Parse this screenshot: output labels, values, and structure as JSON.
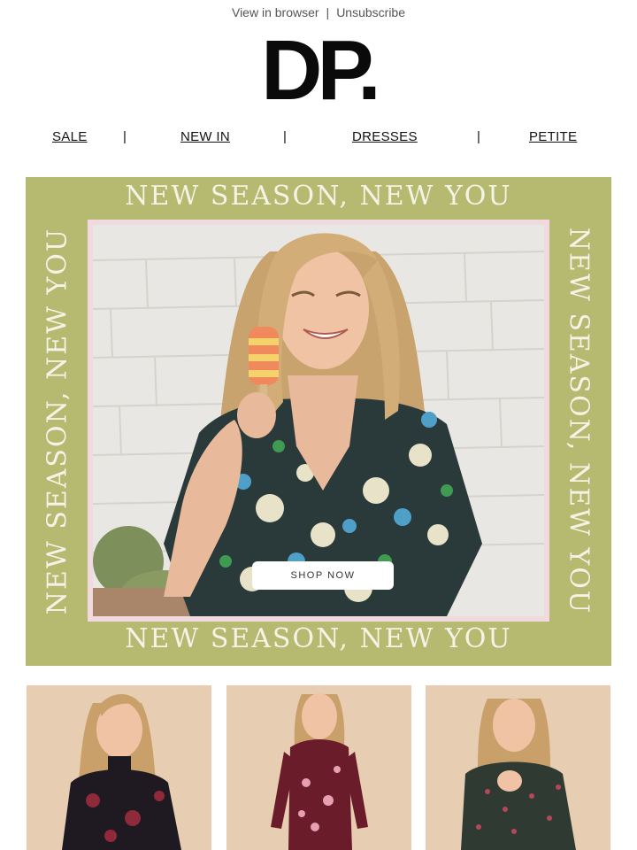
{
  "header": {
    "view_in_browser": "View in browser",
    "separator": "|",
    "unsubscribe": "Unsubscribe",
    "logo": "DP."
  },
  "nav": {
    "items": [
      "SALE",
      "NEW IN",
      "DRESSES",
      "PETITE"
    ],
    "separator": "|"
  },
  "hero": {
    "tagline": "NEW SEASON, NEW YOU",
    "cta": "SHOP NOW",
    "background_color": "#b6ba71",
    "frame_color": "#f1d9e0"
  },
  "products": [
    {
      "name": "black-floral-dress"
    },
    {
      "name": "burgundy-floral-dress"
    },
    {
      "name": "green-print-dress"
    }
  ]
}
